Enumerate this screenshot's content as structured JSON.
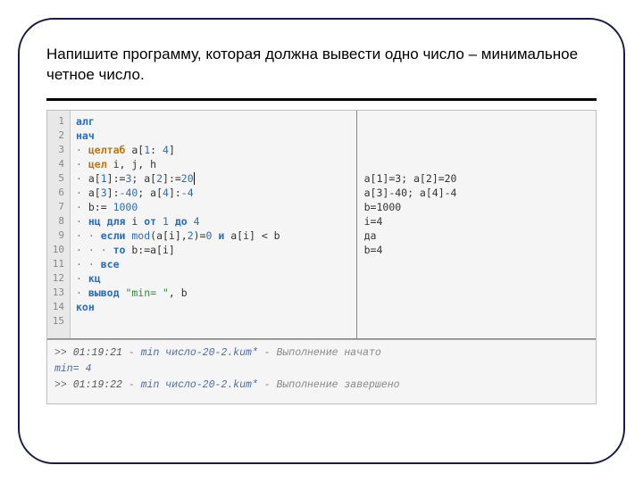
{
  "task": "Напишите программу, которая должна вывести одно число – минимальное четное число.",
  "gutter": [
    "1",
    "2",
    "3",
    "4",
    "5",
    "6",
    "7",
    "8",
    "9",
    "10",
    "11",
    "12",
    "13",
    "14",
    "15"
  ],
  "code": {
    "l1_kw": "алг",
    "l2_kw": "нач",
    "l3_dot": "·",
    "l3_typ": "целтаб",
    "l3_rest1": " a[",
    "l3_n1": "1",
    "l3_colon": ": ",
    "l3_n4": "4",
    "l3_rest2": "]",
    "l4_dot": "·",
    "l4_typ": "цел",
    "l4_rest": " i, j, h",
    "l5_dot": "·",
    "l5_a": " a[",
    "l5_n1": "1",
    "l5_b": "]:=",
    "l5_v1": "3",
    "l5_c": "; a[",
    "l5_n2": "2",
    "l5_d": "]:=",
    "l5_v2": "20",
    "l6_dot": "·",
    "l6_a": " a[",
    "l6_n3": "3",
    "l6_b": "]:",
    "l6_v3": "-40",
    "l6_c": "; a[",
    "l6_n4": "4",
    "l6_d": "]:",
    "l6_v4": "-4",
    "l7_dot": "·",
    "l7_a": " b:= ",
    "l7_v": "1000",
    "l8_dot": "·",
    "l8_kw1": "нц для",
    "l8_a": " i ",
    "l8_kw2": "от",
    "l8_b": " ",
    "l8_n1": "1",
    "l8_c": " ",
    "l8_kw3": "до",
    "l8_d": " ",
    "l8_n4": "4",
    "l9_dot": "· ·",
    "l9_kw": "если",
    "l9_a": " ",
    "l9_fn": "mod",
    "l9_b": "(a[i],",
    "l9_n2": "2",
    "l9_c": ")=",
    "l9_n0": "0",
    "l9_d": " ",
    "l9_kw2": "и",
    "l9_e": " a[i] < b",
    "l10_dot": "· · ·",
    "l10_kw": "то",
    "l10_a": " b:=a[i]",
    "l11_dot": "· ·",
    "l11_kw": "все",
    "l12_dot": "·",
    "l12_kw": "кц",
    "l13_dot": "·",
    "l13_kw": "вывод",
    "l13_a": " ",
    "l13_str": "\"min= \"",
    "l13_b": ", b",
    "l14_kw": "кон"
  },
  "side": {
    "blank1": "",
    "blank2": "",
    "blank3": "",
    "blank4": "",
    "s5": "a[1]=3; a[2]=20",
    "s6": "a[3]-40; a[4]-4",
    "s7": "b=1000",
    "s8": "i=4",
    "s9": "да",
    "s10": "b=4"
  },
  "console": {
    "p1": ">> ",
    "t1": "01:19:21",
    "d1": " - ",
    "f1": "min число-20-2.kum*",
    "m1": " - Выполнение начато",
    "r1": "min= 4",
    "p2": ">> ",
    "t2": "01:19:22",
    "d2": " - ",
    "f2": "min число-20-2.kum*",
    "m2": " - Выполнение завершено"
  }
}
